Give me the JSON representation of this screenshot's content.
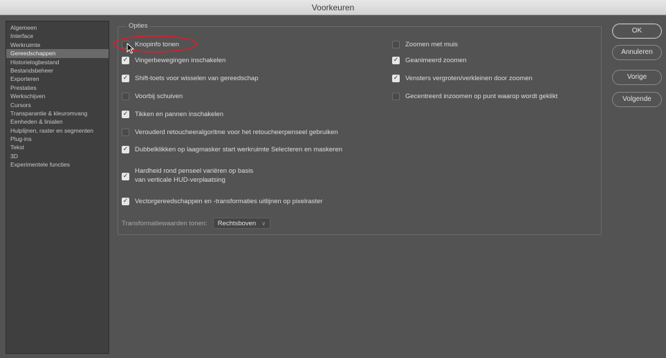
{
  "window": {
    "title": "Voorkeuren"
  },
  "sidebar": {
    "items": [
      {
        "label": "Algemeen",
        "active": false
      },
      {
        "label": "Interface",
        "active": false
      },
      {
        "label": "Werkruimte",
        "active": false
      },
      {
        "label": "Gereedschappen",
        "active": true
      },
      {
        "label": "Historielogbestand",
        "active": false
      },
      {
        "label": "Bestandsbeheer",
        "active": false
      },
      {
        "label": "Exporteren",
        "active": false
      },
      {
        "label": "Prestaties",
        "active": false
      },
      {
        "label": "Werkschijven",
        "active": false
      },
      {
        "label": "Cursors",
        "active": false
      },
      {
        "label": "Transparantie & kleuromvang",
        "active": false
      },
      {
        "label": "Eenheden & linialen",
        "active": false
      },
      {
        "label": "Hulplijnen, raster en segmenten",
        "active": false
      },
      {
        "label": "Plug-ins",
        "active": false
      },
      {
        "label": "Tekst",
        "active": false
      },
      {
        "label": "3D",
        "active": false
      },
      {
        "label": "Experimentele functies",
        "active": false
      }
    ]
  },
  "options": {
    "title": "Opties",
    "left": [
      {
        "label": "Knopinfo tonen",
        "checked": false
      },
      {
        "label": "Vingerbewegingen inschakelen",
        "checked": true
      },
      {
        "label": "Shift-toets voor wisselen van gereedschap",
        "checked": true
      },
      {
        "label": "Voorbij schuiven",
        "checked": false
      },
      {
        "label": "Tikken en pannen inschakelen",
        "checked": true
      },
      {
        "label": "Verouderd retoucheeralgoritme voor het retoucheerpenseel gebruiken",
        "checked": false
      },
      {
        "label": "Dubbelklikken op laagmasker start werkruimte Selecteren en maskeren",
        "checked": true
      },
      {
        "label_line1": "Hardheid rond penseel variëren op basis",
        "label_line2": "van verticale HUD-verplaatsing",
        "checked": true
      },
      {
        "label": "Vectorgereedschappen en -transformaties uitlijnen op pixelraster",
        "checked": true
      }
    ],
    "right": [
      {
        "label": "Zoomen met muis",
        "checked": false
      },
      {
        "label": "Geanimeerd zoomen",
        "checked": true
      },
      {
        "label": "Vensters vergroten/verkleinen door zoomen",
        "checked": true
      },
      {
        "label": "Gecentreerd inzoomen op punt waarop wordt geklikt",
        "checked": false
      }
    ],
    "transform": {
      "label": "Transformatiewaarden tonen:",
      "value": "Rechtsboven"
    }
  },
  "buttons": {
    "ok": "OK",
    "cancel": "Annuleren",
    "prev": "Vorige",
    "next": "Volgende"
  },
  "annotation": {
    "highlight_color": "#d8202a"
  }
}
